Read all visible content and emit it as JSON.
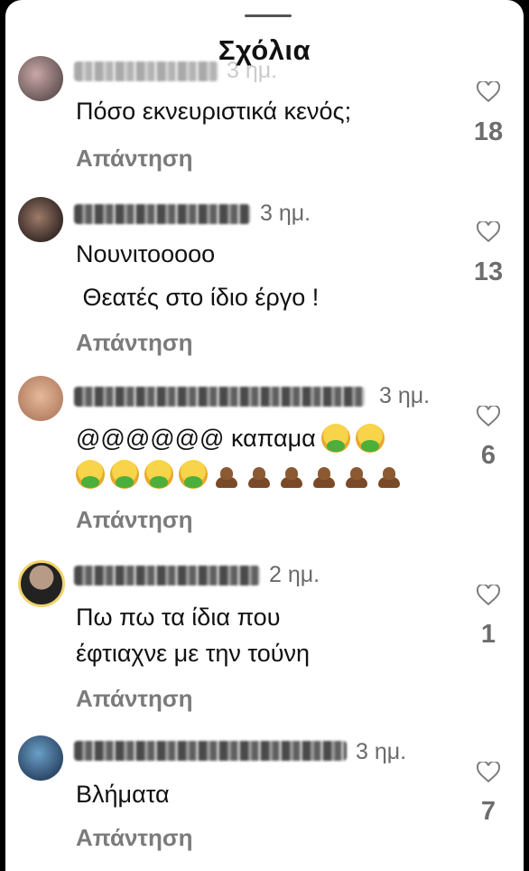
{
  "sheet": {
    "title": "Σχόλια"
  },
  "icons": {
    "like": "heart-outline-icon"
  },
  "colors": {
    "reply": "#7b7b7b",
    "time": "#6a6a6a",
    "likes": "#6d6d6d"
  },
  "comments": [
    {
      "time": "3 ημ.",
      "lines": [
        "Πόσο εκνευριστικά κενός;"
      ],
      "reply_label": "Απάντηση",
      "likes": "18"
    },
    {
      "time": "3 ημ.",
      "lines": [
        "Νουνιτοοooo",
        " Θεατές στο ίδιο έργο !"
      ],
      "reply_label": "Απάντηση",
      "likes": "13"
    },
    {
      "time": "3 ημ.",
      "lines": [
        "@@@@@@ καπαμα"
      ],
      "emojis_line1": [
        "nauseated-face",
        "nauseated-face"
      ],
      "emojis_line2": [
        "nauseated-face",
        "nauseated-face",
        "nauseated-face",
        "nauseated-face",
        "pile-of-poo",
        "pile-of-poo",
        "pile-of-poo",
        "pile-of-poo",
        "pile-of-poo",
        "pile-of-poo"
      ],
      "reply_label": "Απάντηση",
      "likes": "6"
    },
    {
      "time": "2 ημ.",
      "lines": [
        "Πω πω τα ίδια που",
        "έφτιαχνε με την τούνη"
      ],
      "reply_label": "Απάντηση",
      "likes": "1"
    },
    {
      "time": "3 ημ.",
      "lines": [
        "Βλήματα"
      ],
      "reply_label": "Απάντηση",
      "likes": "7"
    }
  ]
}
